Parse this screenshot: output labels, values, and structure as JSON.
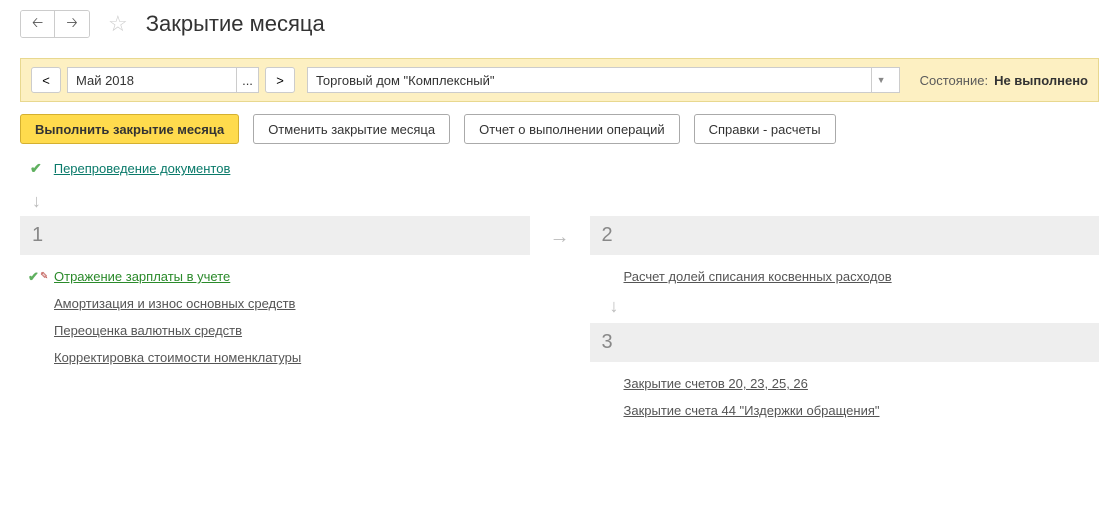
{
  "header": {
    "title": "Закрытие месяца"
  },
  "toolbar": {
    "prev": "<",
    "next": ">",
    "period": "Май 2018",
    "ellipsis": "...",
    "organization": "Торговый дом \"Комплексный\"",
    "status_label": "Состояние:",
    "status_value": "Не выполнено"
  },
  "actions": {
    "execute": "Выполнить закрытие месяца",
    "cancel": "Отменить закрытие месяца",
    "report": "Отчет о выполнении операций",
    "references": "Справки - расчеты"
  },
  "reprocess": {
    "label": "Перепроведение документов"
  },
  "stages": {
    "s1": {
      "num": "1",
      "items": [
        "Отражение зарплаты в учете",
        "Амортизация и износ основных средств",
        "Переоценка валютных средств",
        "Корректировка стоимости номенклатуры"
      ]
    },
    "s2": {
      "num": "2",
      "items": [
        "Расчет долей списания косвенных расходов"
      ]
    },
    "s3": {
      "num": "3",
      "items": [
        "Закрытие счетов 20, 23, 25, 26",
        "Закрытие счета 44 \"Издержки обращения\""
      ]
    }
  }
}
